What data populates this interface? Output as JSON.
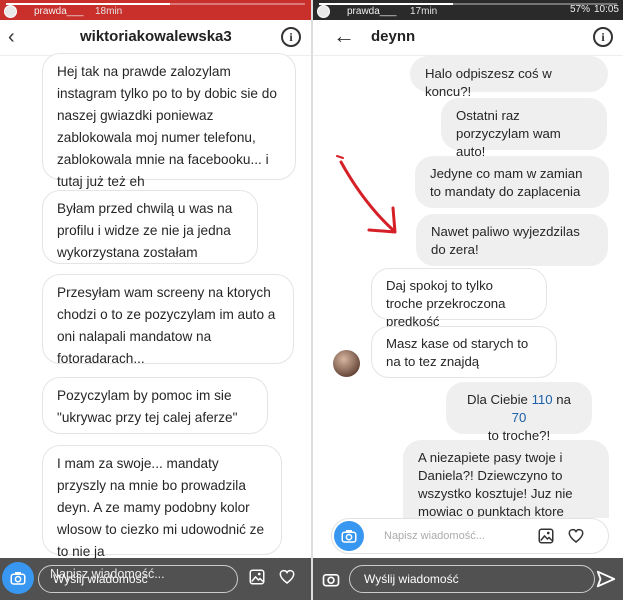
{
  "left": {
    "story": {
      "username": "prawda___",
      "time": "18min"
    },
    "header": {
      "name": "wiktoriakowalewska3"
    },
    "messages": [
      "Hej tak na prawde zalozylam instagram tylko po to by dobic sie do naszej gwiazdki poniewaz zablokowala moj numer telefonu, zablokowala mnie na facebooku... i tutaj już też eh",
      "Byłam przed chwilą u was na profilu i widze ze nie ja jedna wykorzystana zostałam",
      "Przesyłam wam screeny na ktorych chodzi o to ze pozyczylam im auto a oni nalapali mandatow na fotoradarach...",
      "Pozyczylam by pomoc im sie \"ukrywac przy tej calej aferze\"",
      "I mam za swoje... mandaty przyszly na mnie bo prowadzila deyn. A ze mamy podobny kolor wlosow to ciezko mi udowodnić ze to nie ja"
    ],
    "composer_placeholder": "Napisz wiadomość...",
    "reply_placeholder": "Wyślij wiadomość"
  },
  "right": {
    "story": {
      "username": "prawda___",
      "time": "17min"
    },
    "status": {
      "battery": "57%",
      "clock": "10:05"
    },
    "header": {
      "name": "deynn"
    },
    "messages": [
      {
        "dir": "out",
        "text": "Halo odpiszesz coś w koncu?!"
      },
      {
        "dir": "out",
        "text": "Ostatni raz porzyczylam wam auto!"
      },
      {
        "dir": "out",
        "text": "Jedyne co mam w zamian to mandaty do zaplacenia"
      },
      {
        "dir": "out",
        "text": "Nawet paliwo wyjezdzilas do zera!"
      },
      {
        "dir": "in",
        "text": "Daj spokoj to tylko troche przekroczona prędkość"
      },
      {
        "dir": "in",
        "text": "Masz kase od starych to na to tez znajdą"
      },
      {
        "dir": "out",
        "pre": "Dla Ciebie ",
        "n1": "110",
        "mid": " na ",
        "n2": "70",
        "post": "to troche?!"
      },
      {
        "dir": "out",
        "text": "A niezapiete pasy twoje i Daniela?! Dziewczyno to wszystko kosztuje! Juz nie mowiac o punktach ktore"
      }
    ],
    "composer_placeholder": "Napisz wiadomość...",
    "reply_placeholder": "Wyślij wiadomość"
  },
  "colors": {
    "camera": "#3897f0",
    "doodle": "#d62027",
    "highlight": "#1d5fa8"
  }
}
